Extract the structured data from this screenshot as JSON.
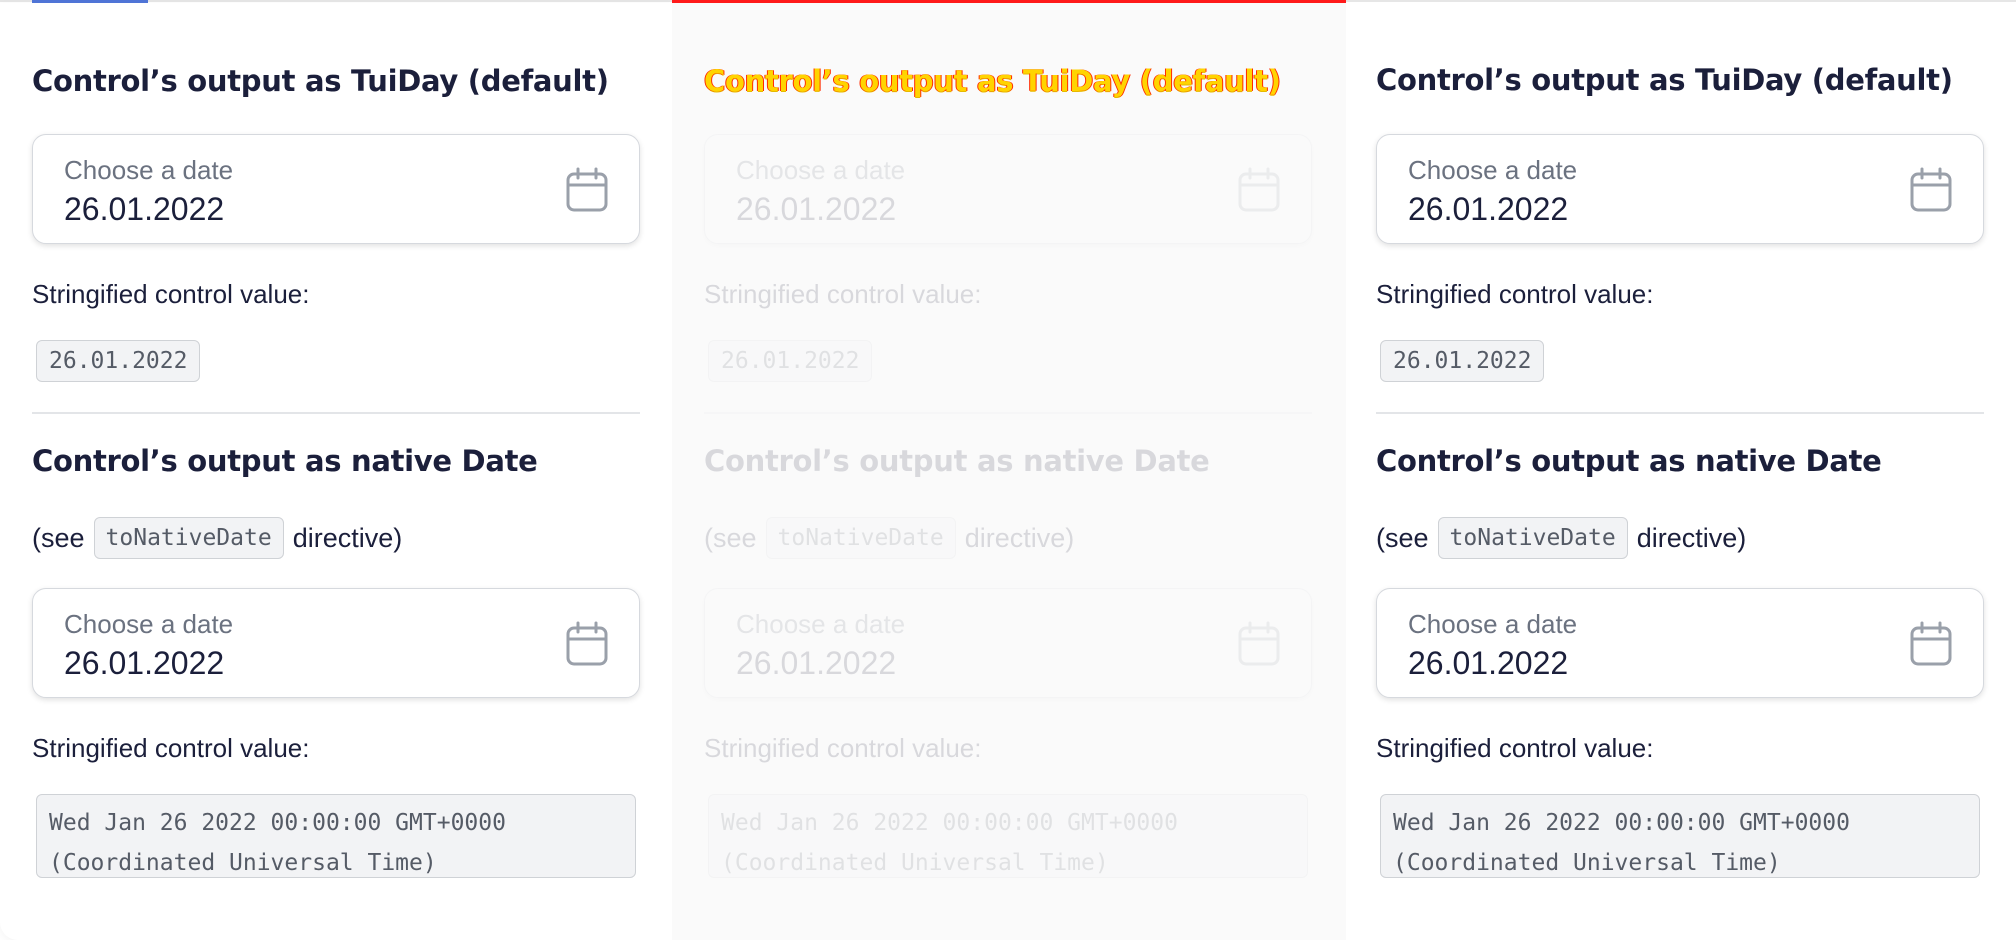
{
  "colors": {
    "accent_tab": "#4f74d6",
    "alert_line": "#ff1a1a",
    "text_dark": "#1b1f3b",
    "text_muted": "#6b7280",
    "code_bg": "#f2f3f5",
    "overlay_text": "#ffd400"
  },
  "panels": [
    {
      "section1": {
        "title": "Control’s output as TuiDay (default)",
        "field": {
          "label": "Choose a date",
          "value": "26.01.2022",
          "icon": "calendar-icon"
        },
        "stringified_label": "Stringified control value:",
        "stringified_value": "26.01.2022"
      },
      "section2": {
        "title": "Control’s output as native Date",
        "see_prefix": "(see",
        "see_code": "toNativeDate",
        "see_suffix": "directive)",
        "field": {
          "label": "Choose a date",
          "value": "26.01.2022",
          "icon": "calendar-icon"
        },
        "stringified_label": "Stringified control value:",
        "stringified_value": "Wed Jan 26 2022 00:00:00 GMT+0000\n(Coordinated Universal Time)"
      }
    },
    {
      "section1": {
        "title": "Control’s output as TuiDay (default)",
        "field": {
          "label": "Choose a date",
          "value": "26.01.2022",
          "icon": "calendar-icon"
        },
        "stringified_label": "Stringified control value:",
        "stringified_value": "26.01.2022"
      },
      "section2": {
        "title": "Control’s output as native Date",
        "see_prefix": "(see",
        "see_code": "toNativeDate",
        "see_suffix": "directive)",
        "field": {
          "label": "Choose a date",
          "value": "26.01.2022",
          "icon": "calendar-icon"
        },
        "stringified_label": "Stringified control value:",
        "stringified_value": "Wed Jan 26 2022 00:00:00 GMT+0000\n(Coordinated Universal Time)"
      }
    },
    {
      "section1": {
        "title": "Control’s output as TuiDay (default)",
        "field": {
          "label": "Choose a date",
          "value": "26.01.2022",
          "icon": "calendar-icon"
        },
        "stringified_label": "Stringified control value:",
        "stringified_value": "26.01.2022"
      },
      "section2": {
        "title": "Control’s output as native Date",
        "see_prefix": "(see",
        "see_code": "toNativeDate",
        "see_suffix": "directive)",
        "field": {
          "label": "Choose a date",
          "value": "26.01.2022",
          "icon": "calendar-icon"
        },
        "stringified_label": "Stringified control value:",
        "stringified_value": "Wed Jan 26 2022 00:00:00 GMT+0000\n(Coordinated Universal Time)"
      }
    }
  ],
  "overlay": {
    "title": "Control’s output as TuiDay (default)"
  }
}
